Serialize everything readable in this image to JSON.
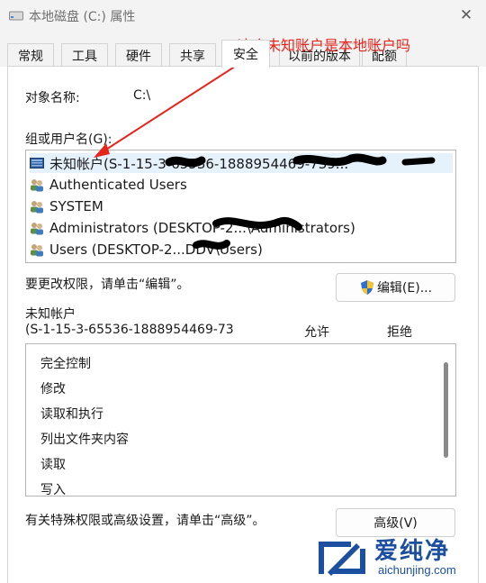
{
  "window": {
    "title": "本地磁盘 (C:) 属性",
    "close_glyph": "✕"
  },
  "tabs": [
    {
      "label": "常规",
      "active": false
    },
    {
      "label": "工具",
      "active": false
    },
    {
      "label": "硬件",
      "active": false
    },
    {
      "label": "共享",
      "active": false
    },
    {
      "label": "安全",
      "active": true
    },
    {
      "label": "以前的版本",
      "active": false
    },
    {
      "label": "配额",
      "active": false
    }
  ],
  "security": {
    "object_name_label": "对象名称:",
    "object_name_value": "C:\\",
    "groups_label": "组或用户名(G):",
    "groups": [
      {
        "name": "未知帐户(S-1-15-3-65536-1888954469-739...",
        "icon": "unknown-account-icon",
        "selected": true
      },
      {
        "name": "Authenticated Users",
        "icon": "users-group-icon",
        "selected": false
      },
      {
        "name": "SYSTEM",
        "icon": "users-group-icon",
        "selected": false
      },
      {
        "name": "Administrators (DESKTOP-2...\\Administrators)",
        "icon": "users-group-icon",
        "selected": false
      },
      {
        "name": "Users (DESKTOP-2...DDV\\Users)",
        "icon": "users-group-icon",
        "selected": false
      }
    ],
    "change_hint": "要更改权限，请单击“编辑”。",
    "edit_button": "编辑(E)...",
    "perm_for_label": "未知帐户",
    "perm_for_sid": "(S-1-15-3-65536-1888954469-73",
    "allow_header": "允许",
    "deny_header": "拒绝",
    "permissions": [
      "完全控制",
      "修改",
      "读取和执行",
      "列出文件夹内容",
      "读取",
      "写入"
    ],
    "advanced_hint": "有关特殊权限或高级设置，请单击“高级”。",
    "advanced_button": "高级(V)"
  },
  "annotation": {
    "text": "这个未知账户是本地账户吗",
    "color": "#e8231a"
  },
  "watermark": {
    "brand_cn": "爱纯净",
    "brand_url": "aichunjing.com"
  }
}
